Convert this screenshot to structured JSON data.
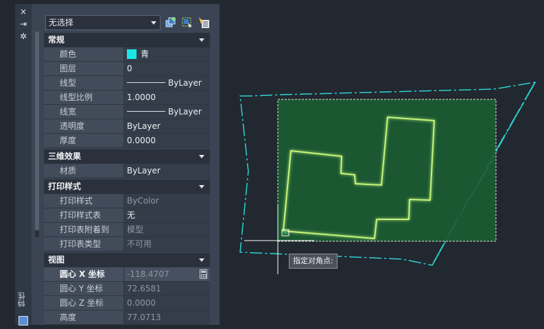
{
  "strip": {
    "title": "特性",
    "controls": [
      "×",
      "⇥",
      "✲"
    ]
  },
  "toolbar": {
    "selection_value": "无选择",
    "icons": [
      "toggle-pickadd-icon",
      "select-objects-icon",
      "quick-select-icon"
    ]
  },
  "sections": [
    {
      "title": "常规",
      "rows": [
        {
          "label": "颜色",
          "value": "青",
          "swatch": "#19e6e6"
        },
        {
          "label": "图层",
          "value": "0"
        },
        {
          "label": "线型",
          "value": "ByLayer",
          "line": true
        },
        {
          "label": "线型比例",
          "value": "1.0000"
        },
        {
          "label": "线宽",
          "value": "ByLayer",
          "line": true
        },
        {
          "label": "透明度",
          "value": "ByLayer"
        },
        {
          "label": "厚度",
          "value": "0.0000"
        }
      ]
    },
    {
      "title": "三维效果",
      "rows": [
        {
          "label": "材质",
          "value": "ByLayer"
        }
      ]
    },
    {
      "title": "打印样式",
      "rows": [
        {
          "label": "打印样式",
          "value": "ByColor",
          "dim": true
        },
        {
          "label": "打印样式表",
          "value": "无"
        },
        {
          "label": "打印表附着到",
          "value": "模型",
          "dim": true
        },
        {
          "label": "打印表类型",
          "value": "不可用",
          "dim": true
        }
      ]
    },
    {
      "title": "视图",
      "rows": [
        {
          "label": "圆心 X 坐标",
          "value": "-118.4707",
          "dim": true,
          "bold": true,
          "calc": true
        },
        {
          "label": "圆心 Y 坐标",
          "value": "72.6581",
          "dim": true
        },
        {
          "label": "圆心 Z 坐标",
          "value": "0.0000",
          "dim": true
        },
        {
          "label": "高度",
          "value": "77.0713",
          "dim": true
        }
      ]
    }
  ],
  "canvas": {
    "tooltip": "指定对角点:",
    "colors": {
      "boundary": "#2fd3d3",
      "building": "#b8f060",
      "selection_fill": "#1b5c33",
      "background": "#212830"
    }
  }
}
